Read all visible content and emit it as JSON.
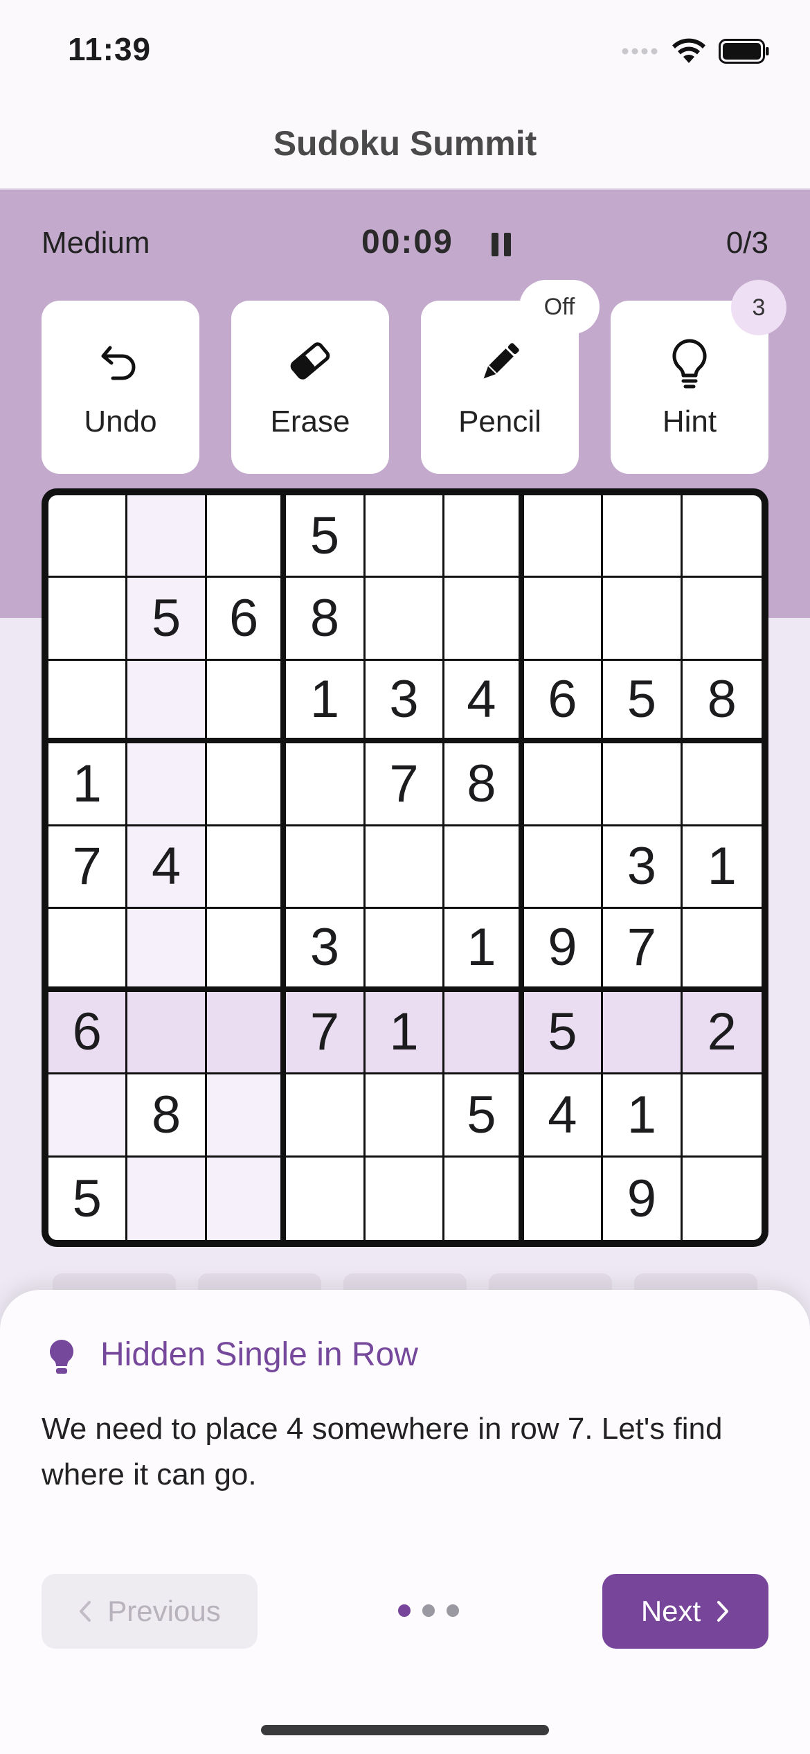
{
  "status": {
    "time": "11:39"
  },
  "header": {
    "title": "Sudoku Summit"
  },
  "game": {
    "difficulty": "Medium",
    "timer": "00:09",
    "mistakes": "0/3"
  },
  "tools": {
    "undo": {
      "label": "Undo",
      "icon": "undo-icon"
    },
    "erase": {
      "label": "Erase",
      "icon": "eraser-icon"
    },
    "pencil": {
      "label": "Pencil",
      "icon": "pencil-icon",
      "badge": "Off"
    },
    "hint": {
      "label": "Hint",
      "icon": "lightbulb-icon",
      "badge": "3"
    }
  },
  "board": {
    "rows": [
      [
        "",
        "",
        "",
        "5",
        "",
        "",
        "",
        "",
        ""
      ],
      [
        "",
        "5",
        "6",
        "8",
        "",
        "",
        "",
        "",
        ""
      ],
      [
        "",
        "",
        "",
        "1",
        "3",
        "4",
        "6",
        "5",
        "8"
      ],
      [
        "1",
        "",
        "",
        "",
        "7",
        "8",
        "",
        "",
        ""
      ],
      [
        "7",
        "4",
        "",
        "",
        "",
        "",
        "",
        "3",
        "1"
      ],
      [
        "",
        "",
        "",
        "3",
        "",
        "1",
        "9",
        "7",
        ""
      ],
      [
        "6",
        "",
        "",
        "7",
        "1",
        "",
        "5",
        "",
        "2"
      ],
      [
        "",
        "8",
        "",
        "",
        "",
        "5",
        "4",
        "1",
        ""
      ],
      [
        "5",
        "",
        "",
        "",
        "",
        "",
        "",
        "9",
        ""
      ]
    ],
    "highlighted_row": 7,
    "highlight_colors": {
      "row": "#EBDDF1",
      "related": "#F5F0F9"
    }
  },
  "hint_panel": {
    "title": "Hidden Single in Row",
    "text": "We need to place 4 somewhere in row 7. Let's find where it can go.",
    "previous_label": "Previous",
    "next_label": "Next",
    "step_count": 3,
    "current_step": 1
  },
  "colors": {
    "accent": "#774599",
    "band": "#C3A9CC",
    "background": "#EDE8F3"
  }
}
